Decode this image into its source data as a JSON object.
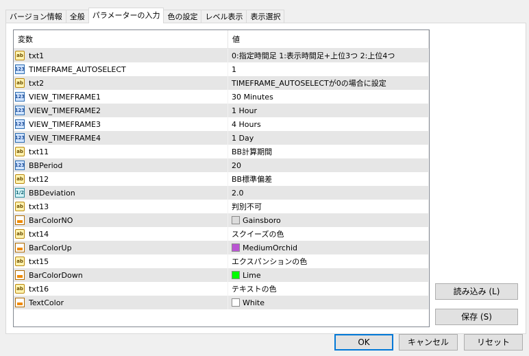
{
  "tabs": [
    {
      "label": "バージョン情報"
    },
    {
      "label": "全般"
    },
    {
      "label": "パラメーターの入力"
    },
    {
      "label": "色の設定"
    },
    {
      "label": "レベル表示"
    },
    {
      "label": "表示選択"
    }
  ],
  "table": {
    "headers": {
      "variable": "変数",
      "value": "値"
    },
    "rows": [
      {
        "icon": "ab",
        "name": "txt1",
        "value": "0:指定時間足 1:表示時間足+上位3つ 2:上位4つ"
      },
      {
        "icon": "num",
        "name": "TIMEFRAME_AUTOSELECT",
        "value": "1"
      },
      {
        "icon": "ab",
        "name": "txt2",
        "value": "TIMEFRAME_AUTOSELECTが0の場合に設定"
      },
      {
        "icon": "num",
        "name": "VIEW_TIMEFRAME1",
        "value": "30 Minutes"
      },
      {
        "icon": "num",
        "name": "VIEW_TIMEFRAME2",
        "value": "1 Hour"
      },
      {
        "icon": "num",
        "name": "VIEW_TIMEFRAME3",
        "value": "4 Hours"
      },
      {
        "icon": "num",
        "name": "VIEW_TIMEFRAME4",
        "value": "1 Day"
      },
      {
        "icon": "ab",
        "name": "txt11",
        "value": "BB計算期間"
      },
      {
        "icon": "num",
        "name": "BBPeriod",
        "value": "20"
      },
      {
        "icon": "ab",
        "name": "txt12",
        "value": "BB標準偏差"
      },
      {
        "icon": "frac",
        "name": "BBDeviation",
        "value": "2.0"
      },
      {
        "icon": "ab",
        "name": "txt13",
        "value": "判別不可"
      },
      {
        "icon": "color",
        "name": "BarColorNO",
        "value": "Gainsboro",
        "swatch": "#dcdcdc"
      },
      {
        "icon": "ab",
        "name": "txt14",
        "value": "スクイーズの色"
      },
      {
        "icon": "color",
        "name": "BarColorUp",
        "value": "MediumOrchid",
        "swatch": "#ba55d3"
      },
      {
        "icon": "ab",
        "name": "txt15",
        "value": "エクスパンションの色"
      },
      {
        "icon": "color",
        "name": "BarColorDown",
        "value": "Lime",
        "swatch": "#00ff00"
      },
      {
        "icon": "ab",
        "name": "txt16",
        "value": "テキストの色"
      },
      {
        "icon": "color",
        "name": "TextColor",
        "value": "White",
        "swatch": "#ffffff"
      }
    ]
  },
  "icons": {
    "ab": "ab",
    "num": "123",
    "frac": "1/2"
  },
  "buttons": {
    "load": "読み込み (L)",
    "save": "保存 (S)",
    "ok": "OK",
    "cancel": "キャンセル",
    "reset": "リセット"
  }
}
